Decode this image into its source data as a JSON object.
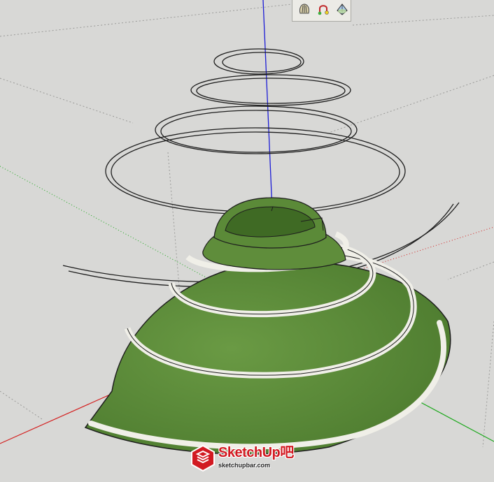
{
  "app": {
    "name": "SketchUp"
  },
  "toolbar": {
    "tools": [
      {
        "icon": "shell-icon"
      },
      {
        "icon": "follow-path-icon"
      },
      {
        "icon": "soften-edges-icon"
      }
    ]
  },
  "axes": {
    "blue": "#1c1cd6",
    "red": "#d42020",
    "green": "#1aa81a"
  },
  "model": {
    "surface_color": "#5d8a3a",
    "edge_color": "#1e1e1e"
  },
  "watermark": {
    "brand_main": "SketchUp",
    "brand_suffix": "吧",
    "url": "sketchupbar.com"
  }
}
